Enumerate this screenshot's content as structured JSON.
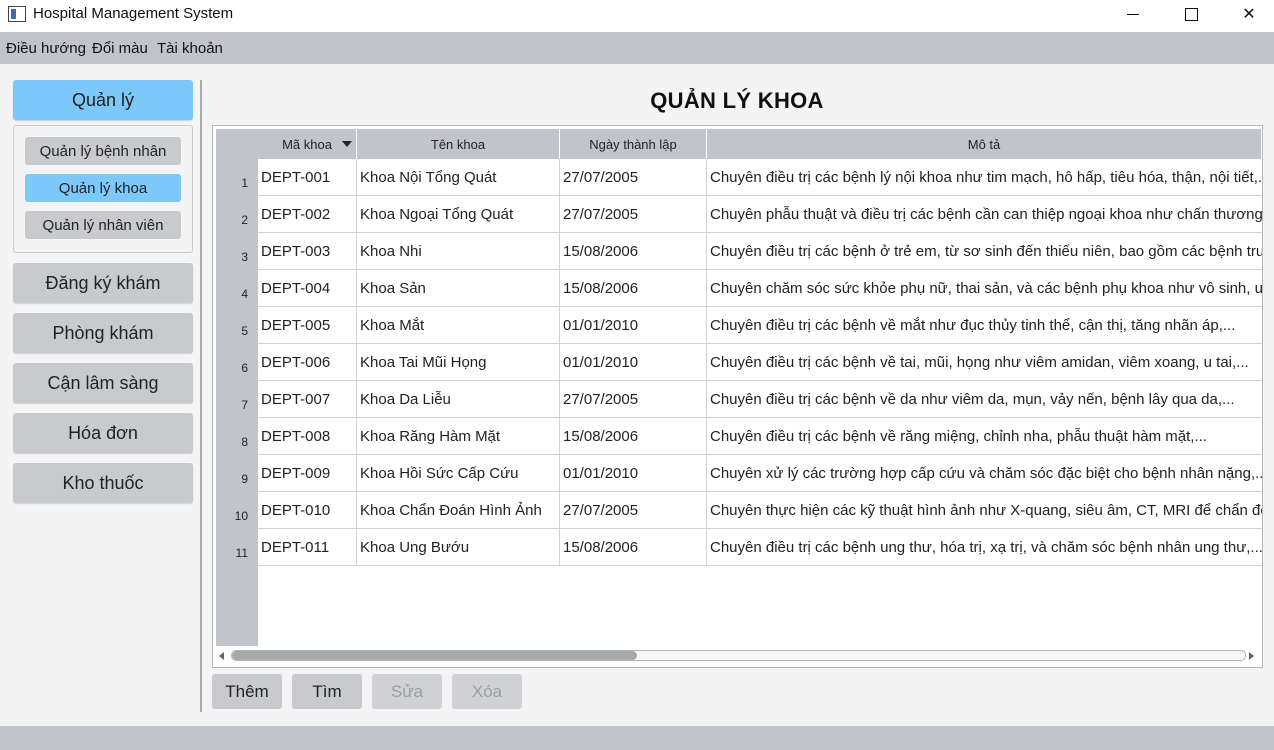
{
  "window": {
    "title": "Hospital Management System"
  },
  "menu": [
    "Điều hướng",
    "Đổi màu",
    "Tài khoản"
  ],
  "sidebar": {
    "group_label": "Quản lý",
    "sub_items": [
      "Quản lý bệnh nhân",
      "Quản lý khoa",
      "Quản lý nhân viên"
    ],
    "active_sub": "Quản lý khoa",
    "items": [
      "Đăng ký khám",
      "Phòng khám",
      "Cận lâm sàng",
      "Hóa đơn",
      "Kho thuốc"
    ]
  },
  "page": {
    "title": "QUẢN LÝ KHOA"
  },
  "table": {
    "columns": [
      "Mã khoa",
      "Tên khoa",
      "Ngày thành lập",
      "Mô tả"
    ],
    "sorted_column": "Mã khoa",
    "rows": [
      {
        "num": "1",
        "id": "DEPT-001",
        "name": "Khoa Nội Tổng Quát",
        "date": "27/07/2005",
        "desc": "Chuyên điều trị các bệnh lý nội khoa như tim mạch, hô hấp, tiêu hóa, thận, nội tiết,..."
      },
      {
        "num": "2",
        "id": "DEPT-002",
        "name": "Khoa Ngoại Tổng Quát",
        "date": "27/07/2005",
        "desc": "Chuyên phẫu thuật và điều trị các bệnh cần can thiệp ngoại khoa như chấn thương, v"
      },
      {
        "num": "3",
        "id": "DEPT-003",
        "name": "Khoa Nhi",
        "date": "15/08/2006",
        "desc": "Chuyên điều trị các bệnh ở trẻ em, từ sơ sinh đến thiếu niên, bao gồm các bệnh truy"
      },
      {
        "num": "4",
        "id": "DEPT-004",
        "name": "Khoa Sản",
        "date": "15/08/2006",
        "desc": "Chuyên chăm sóc sức khỏe phụ nữ, thai sản, và các bệnh phụ khoa như vô sinh, u xơ"
      },
      {
        "num": "5",
        "id": "DEPT-005",
        "name": "Khoa Mắt",
        "date": "01/01/2010",
        "desc": "Chuyên điều trị các bệnh về mắt như đục thủy tinh thể, cận thị, tăng nhãn áp,..."
      },
      {
        "num": "6",
        "id": "DEPT-006",
        "name": "Khoa Tai Mũi Họng",
        "date": "01/01/2010",
        "desc": "Chuyên điều trị các bệnh về tai, mũi, họng như viêm amidan, viêm xoang, u tai,..."
      },
      {
        "num": "7",
        "id": "DEPT-007",
        "name": "Khoa Da Liễu",
        "date": "27/07/2005",
        "desc": "Chuyên điều trị các bệnh về da như viêm da, mụn, vảy nến, bệnh lây qua da,..."
      },
      {
        "num": "8",
        "id": "DEPT-008",
        "name": "Khoa Răng Hàm Mặt",
        "date": "15/08/2006",
        "desc": "Chuyên điều trị các bệnh về răng miệng, chỉnh nha, phẫu thuật hàm mặt,..."
      },
      {
        "num": "9",
        "id": "DEPT-009",
        "name": "Khoa Hồi Sức Cấp Cứu",
        "date": "01/01/2010",
        "desc": "Chuyên xử lý các trường hợp cấp cứu và chăm sóc đặc biệt cho bệnh nhân nặng,..."
      },
      {
        "num": "10",
        "id": "DEPT-010",
        "name": "Khoa Chẩn Đoán Hình Ảnh",
        "date": "27/07/2005",
        "desc": "Chuyên thực hiện các kỹ thuật hình ảnh như X-quang, siêu âm, CT, MRI để chẩn đoán"
      },
      {
        "num": "11",
        "id": "DEPT-011",
        "name": "Khoa Ung Bướu",
        "date": "15/08/2006",
        "desc": "Chuyên điều trị các bệnh ung thư, hóa trị, xạ trị, và chăm sóc bệnh nhân ung thư,..."
      }
    ],
    "hscroll_fraction": 0.4
  },
  "actions": {
    "add": "Thêm",
    "find": "Tìm",
    "edit": "Sửa",
    "delete": "Xóa",
    "disabled": [
      "Sửa",
      "Xóa"
    ]
  }
}
